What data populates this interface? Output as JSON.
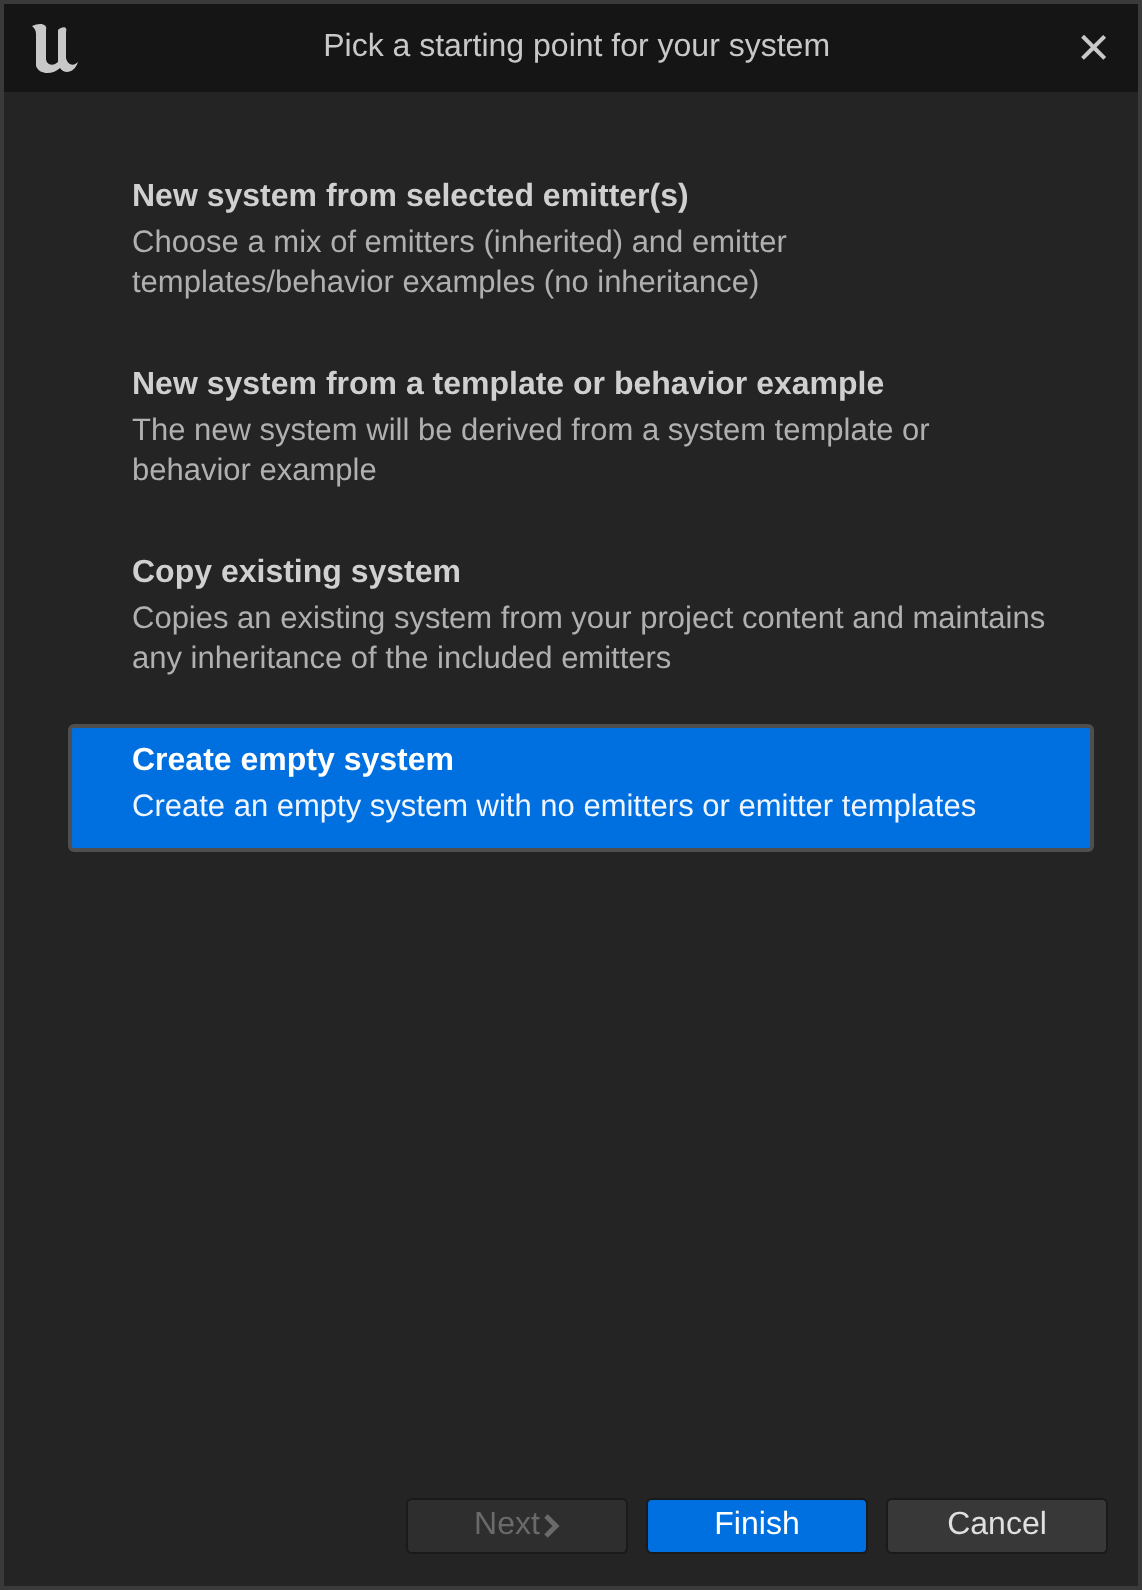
{
  "window": {
    "title": "Pick a starting point for your system",
    "close": "×"
  },
  "options": [
    {
      "title": "New system from selected emitter(s)",
      "description": "Choose a mix of emitters (inherited) and emitter templates/behavior examples (no inheritance)",
      "selected": false
    },
    {
      "title": "New system from a template or behavior example",
      "description": "The new system will be derived from a system template or behavior example",
      "selected": false
    },
    {
      "title": "Copy existing system",
      "description": "Copies an existing system from your project content and maintains any inheritance of the included emitters",
      "selected": false
    },
    {
      "title": "Create empty system",
      "description": "Create an empty system with no emitters or emitter templates",
      "selected": true
    }
  ],
  "buttons": [
    {
      "label": "Next",
      "kind": "next",
      "disabled": true
    },
    {
      "label": "Finish",
      "kind": "primary",
      "disabled": false
    },
    {
      "label": "Cancel",
      "kind": "normal",
      "disabled": false
    }
  ]
}
